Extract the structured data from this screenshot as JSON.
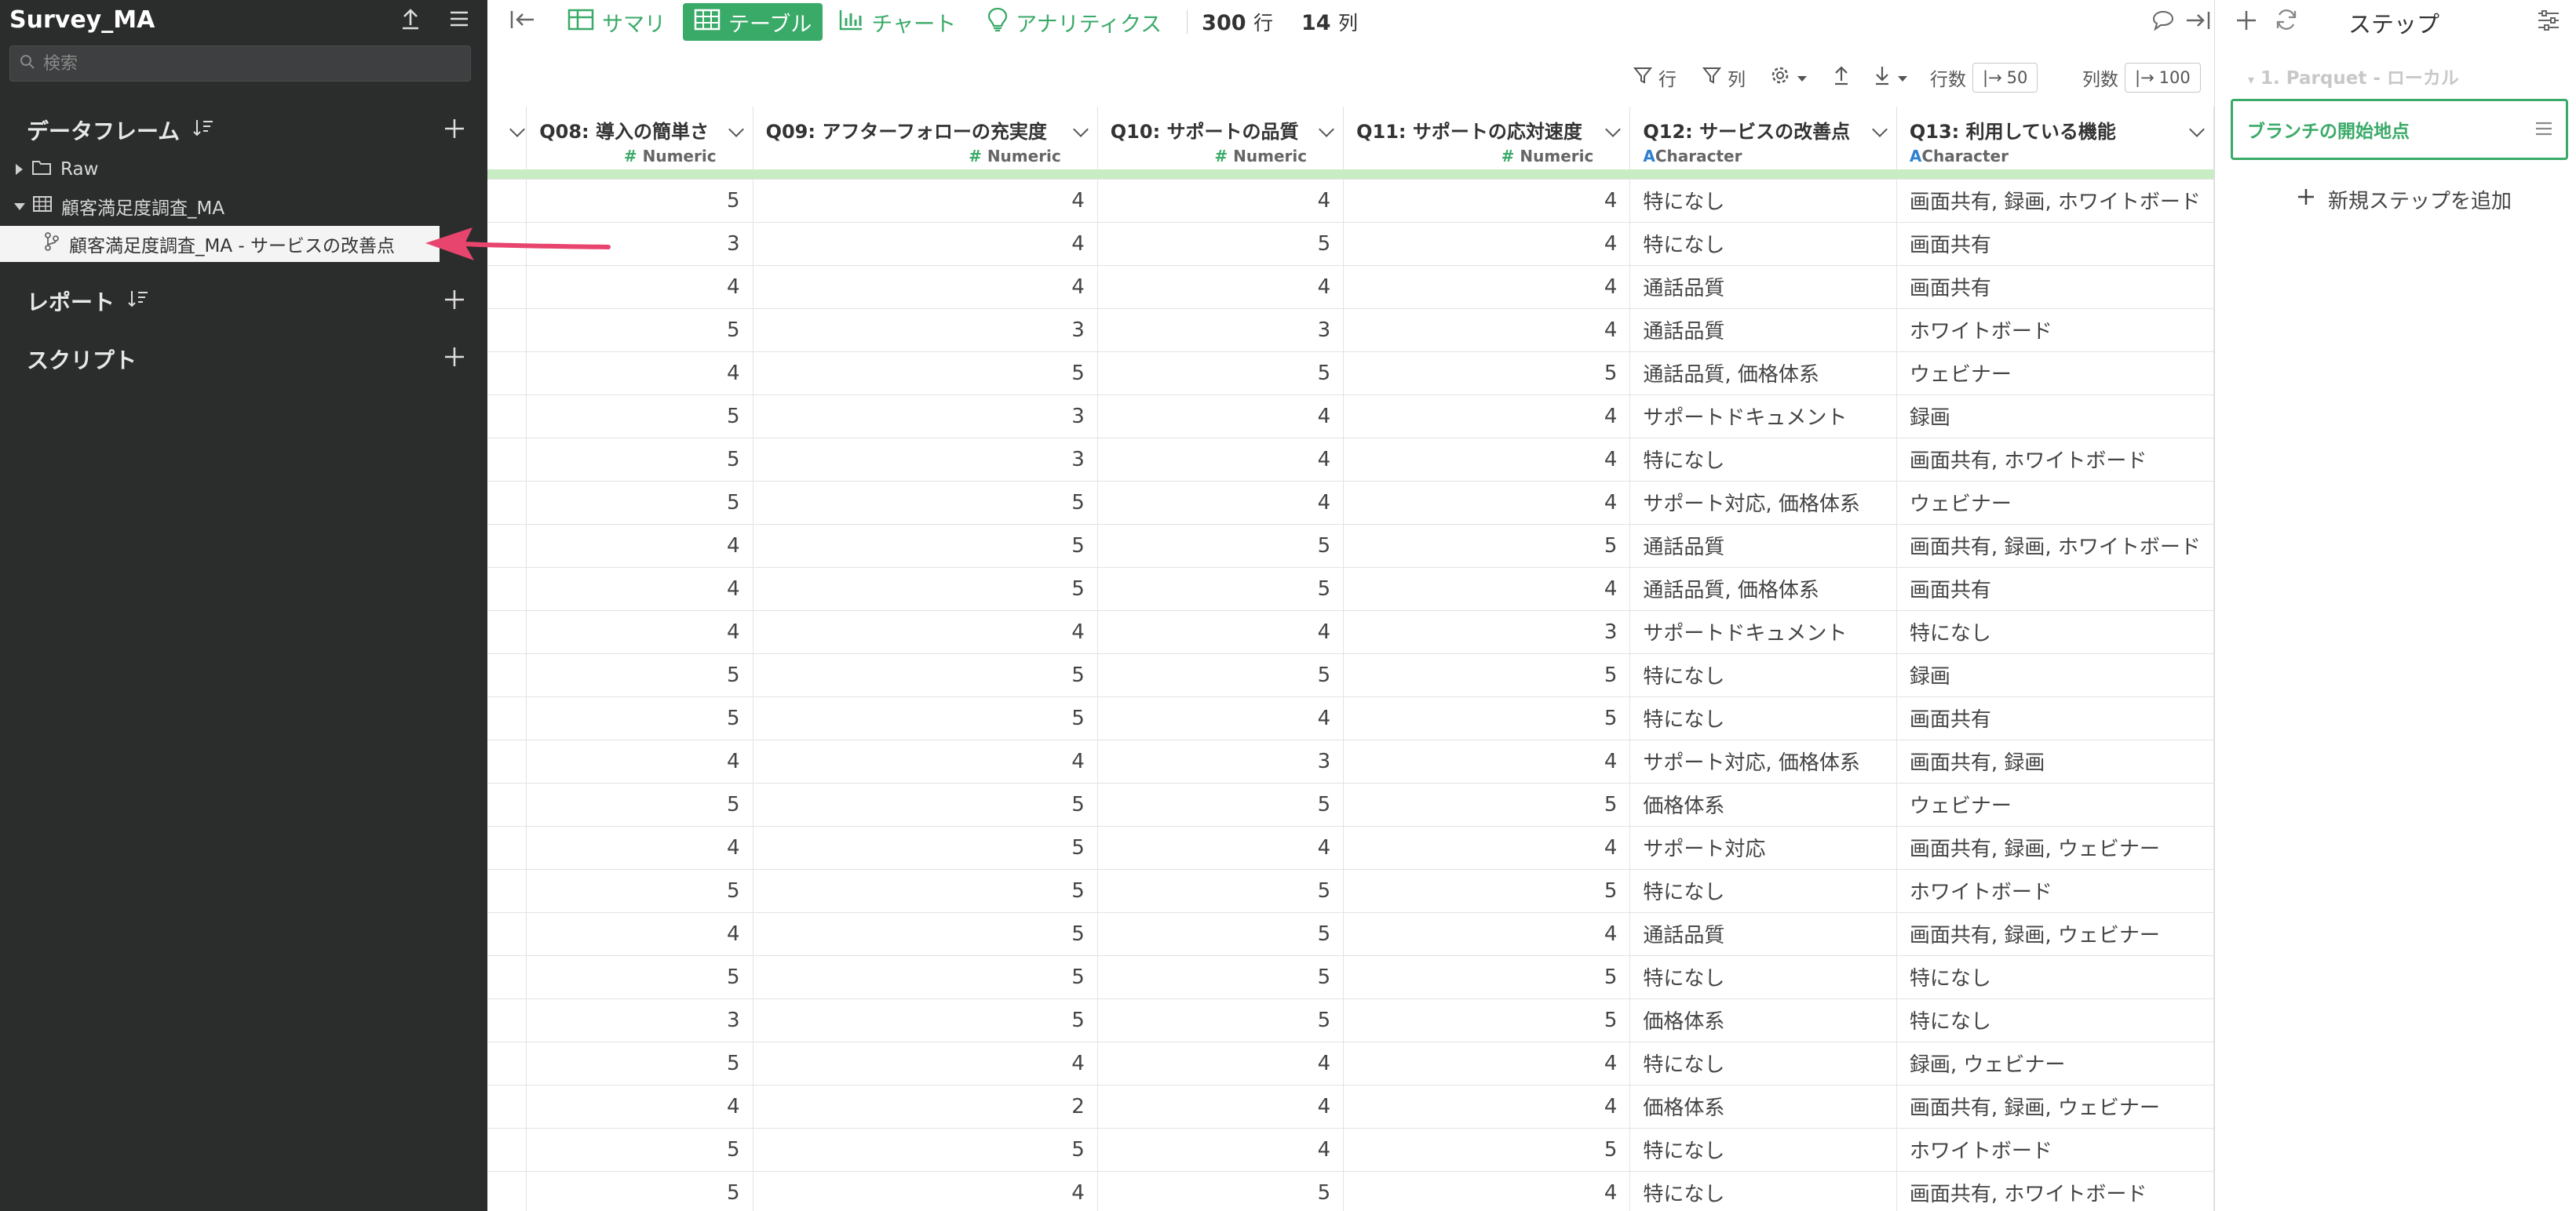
{
  "sidebar": {
    "project_name": "Survey_MA",
    "search_placeholder": "検索",
    "dataframes_label": "データフレーム",
    "tree": [
      {
        "label": "Raw"
      },
      {
        "label": "顧客満足度調査_MA"
      },
      {
        "label": "顧客満足度調査_MA - サービスの改善点"
      }
    ],
    "reports_label": "レポート",
    "scripts_label": "スクリプト"
  },
  "toolbar": {
    "summary_label": "サマリ",
    "table_label": "テーブル",
    "chart_label": "チャート",
    "analytics_label": "アナリティクス",
    "rows_count": "300",
    "rows_unit": "行",
    "cols_count": "14",
    "cols_unit": "列"
  },
  "table_controls": {
    "row_filter_label": "行",
    "col_filter_label": "列",
    "row_count_label": "行数",
    "row_count_value": "50",
    "col_count_label": "列数",
    "col_count_value": "100"
  },
  "table": {
    "columns": [
      {
        "title": "Q08: 導入の簡単さ",
        "type": "Numeric"
      },
      {
        "title": "Q09: アフターフォローの充実度",
        "type": "Numeric"
      },
      {
        "title": "Q10: サポートの品質",
        "type": "Numeric"
      },
      {
        "title": "Q11: サポートの応対速度",
        "type": "Numeric"
      },
      {
        "title": "Q12: サービスの改善点",
        "type": "Character"
      },
      {
        "title": "Q13: 利用している機能",
        "type": "Character"
      }
    ],
    "rows": [
      [
        "5",
        "4",
        "4",
        "4",
        "特になし",
        "画面共有, 録画, ホワイトボード"
      ],
      [
        "3",
        "4",
        "5",
        "4",
        "特になし",
        "画面共有"
      ],
      [
        "4",
        "4",
        "4",
        "4",
        "通話品質",
        "画面共有"
      ],
      [
        "5",
        "3",
        "3",
        "4",
        "通話品質",
        "ホワイトボード"
      ],
      [
        "4",
        "5",
        "5",
        "5",
        "通話品質, 価格体系",
        "ウェビナー"
      ],
      [
        "5",
        "3",
        "4",
        "4",
        "サポートドキュメント",
        "録画"
      ],
      [
        "5",
        "3",
        "4",
        "4",
        "特になし",
        "画面共有, ホワイトボード"
      ],
      [
        "5",
        "5",
        "4",
        "4",
        "サポート対応, 価格体系",
        "ウェビナー"
      ],
      [
        "4",
        "5",
        "5",
        "5",
        "通話品質",
        "画面共有, 録画, ホワイトボード"
      ],
      [
        "4",
        "5",
        "5",
        "4",
        "通話品質, 価格体系",
        "画面共有"
      ],
      [
        "4",
        "4",
        "4",
        "3",
        "サポートドキュメント",
        "特になし"
      ],
      [
        "5",
        "5",
        "5",
        "5",
        "特になし",
        "録画"
      ],
      [
        "5",
        "5",
        "4",
        "5",
        "特になし",
        "画面共有"
      ],
      [
        "4",
        "4",
        "3",
        "4",
        "サポート対応, 価格体系",
        "画面共有, 録画"
      ],
      [
        "5",
        "5",
        "5",
        "5",
        "価格体系",
        "ウェビナー"
      ],
      [
        "4",
        "5",
        "4",
        "4",
        "サポート対応",
        "画面共有, 録画, ウェビナー"
      ],
      [
        "5",
        "5",
        "5",
        "5",
        "特になし",
        "ホワイトボード"
      ],
      [
        "4",
        "5",
        "5",
        "4",
        "通話品質",
        "画面共有, 録画, ウェビナー"
      ],
      [
        "5",
        "5",
        "5",
        "5",
        "特になし",
        "特になし"
      ],
      [
        "3",
        "5",
        "5",
        "5",
        "価格体系",
        "特になし"
      ],
      [
        "5",
        "4",
        "4",
        "4",
        "特になし",
        "録画, ウェビナー"
      ],
      [
        "4",
        "2",
        "4",
        "4",
        "価格体系",
        "画面共有, 録画, ウェビナー"
      ],
      [
        "5",
        "5",
        "4",
        "5",
        "特になし",
        "ホワイトボード"
      ],
      [
        "5",
        "4",
        "5",
        "4",
        "特になし",
        "画面共有, ホワイトボード"
      ]
    ]
  },
  "steps": {
    "title": "ステップ",
    "source_step": "1. Parquet - ローカル",
    "branch_label": "ブランチの開始地点",
    "add_step_label": "新規ステップを追加"
  },
  "colors": {
    "accent_green": "#3aaa68",
    "sidebar_bg": "#2b2c2c",
    "annotation_arrow": "#e8456e",
    "header_bar": "#c8ecc4"
  }
}
